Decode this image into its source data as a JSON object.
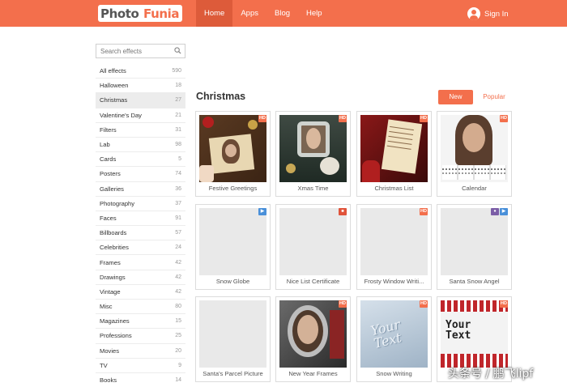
{
  "header": {
    "logo_left": "Photo",
    "logo_right": "Funia",
    "nav": [
      "Home",
      "Apps",
      "Blog",
      "Help"
    ],
    "signin": "Sign In",
    "colors": {
      "brand": "#f36f4c",
      "nav_active": "#dd5b3a"
    }
  },
  "sidebar": {
    "search_placeholder": "Search effects",
    "categories": [
      {
        "label": "All effects",
        "count": "590"
      },
      {
        "label": "Halloween",
        "count": "18"
      },
      {
        "label": "Christmas",
        "count": "27"
      },
      {
        "label": "Valentine's Day",
        "count": "21"
      },
      {
        "label": "Filters",
        "count": "31"
      },
      {
        "label": "Lab",
        "count": "98"
      },
      {
        "label": "Cards",
        "count": "5"
      },
      {
        "label": "Posters",
        "count": "74"
      },
      {
        "label": "Galleries",
        "count": "36"
      },
      {
        "label": "Photography",
        "count": "37"
      },
      {
        "label": "Faces",
        "count": "91"
      },
      {
        "label": "Billboards",
        "count": "57"
      },
      {
        "label": "Celebrities",
        "count": "24"
      },
      {
        "label": "Frames",
        "count": "42"
      },
      {
        "label": "Drawings",
        "count": "42"
      },
      {
        "label": "Vintage",
        "count": "42"
      },
      {
        "label": "Misc",
        "count": "80"
      },
      {
        "label": "Magazines",
        "count": "15"
      },
      {
        "label": "Professions",
        "count": "25"
      },
      {
        "label": "Movies",
        "count": "20"
      },
      {
        "label": "TV",
        "count": "9"
      },
      {
        "label": "Books",
        "count": "14"
      }
    ]
  },
  "main": {
    "title": "Christmas",
    "sort_new": "New",
    "sort_popular": "Popular",
    "effects": [
      {
        "name": "Festive Greetings",
        "badges": [
          "HD"
        ]
      },
      {
        "name": "Xmas Time",
        "badges": [
          "HD"
        ]
      },
      {
        "name": "Christmas List",
        "badges": [
          "HD"
        ]
      },
      {
        "name": "Calendar",
        "badges": [
          "HD"
        ]
      },
      {
        "name": "Snow Globe",
        "badges": [
          "video"
        ]
      },
      {
        "name": "Nice List Certificate",
        "badges": [
          "print"
        ]
      },
      {
        "name": "Frosty Window Writi...",
        "badges": [
          "HD"
        ]
      },
      {
        "name": "Santa Snow Angel",
        "badges": [
          "user",
          "video"
        ]
      },
      {
        "name": "Santa's Parcel Picture",
        "badges": []
      },
      {
        "name": "New Year Frames",
        "badges": [
          "HD"
        ]
      },
      {
        "name": "Snow Writing",
        "badges": [
          "HD"
        ]
      },
      {
        "name": "",
        "badges": [
          "HD"
        ]
      }
    ],
    "snow_text": "Your Text",
    "sweater_text": "Your Text"
  },
  "watermark": "头条号 / 鹏飞lipf"
}
